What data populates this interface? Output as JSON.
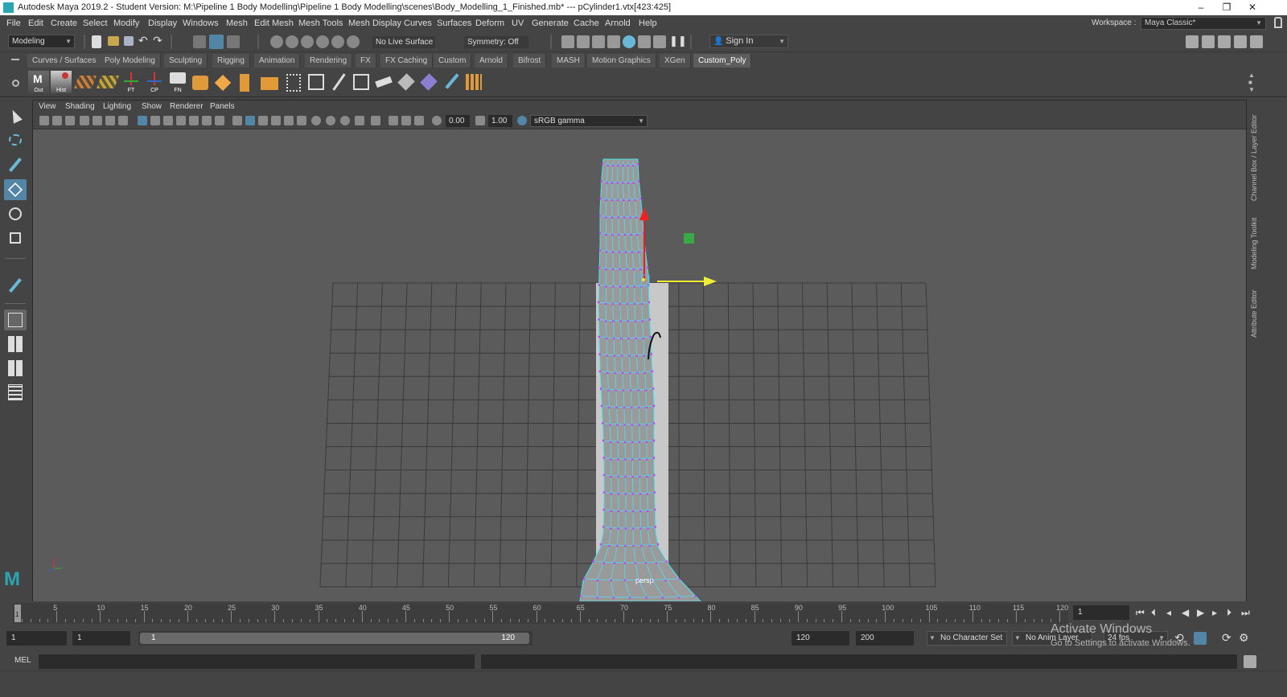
{
  "titlebar": {
    "title": "Autodesk Maya 2019.2 - Student Version: M:\\Pipeline 1 Body Modelling\\Pipeline 1 Body Modelling\\scenes\\Body_Modelling_1_Finished.mb*  ---  pCylinder1.vtx[423:425]",
    "minimize": "–",
    "restore": "❐",
    "close": "✕"
  },
  "menubar": {
    "items": [
      "File",
      "Edit",
      "Create",
      "Select",
      "Modify",
      "Display",
      "Windows",
      "Mesh",
      "Edit Mesh",
      "Mesh Tools",
      "Mesh Display",
      "Curves",
      "Surfaces",
      "Deform",
      "UV",
      "Generate",
      "Cache",
      "Arnold",
      "Help"
    ],
    "workspace_label": "Workspace :",
    "workspace_value": "Maya Classic*"
  },
  "statusline": {
    "menu_set": "Modeling",
    "live_surface": "No Live Surface",
    "symmetry": "Symmetry: Off",
    "sign_in": "Sign In"
  },
  "shelf": {
    "tabs": [
      "Curves / Surfaces",
      "Poly Modeling",
      "Sculpting",
      "Rigging",
      "Animation",
      "Rendering",
      "FX",
      "FX Caching",
      "Custom",
      "Arnold",
      "Bifrost",
      "MASH",
      "Motion Graphics",
      "XGen",
      "Custom_Poly"
    ],
    "active_tab": "Custom_Poly",
    "icon_labels": [
      "Out",
      "Hist",
      "FT",
      "CP",
      "FN"
    ]
  },
  "viewport": {
    "panel_menu": [
      "View",
      "Shading",
      "Lighting",
      "Show",
      "Renderer",
      "Panels"
    ],
    "exposure": "0.00",
    "gamma": "1.00",
    "color_space": "sRGB gamma",
    "camera_label": "persp"
  },
  "right_dock": {
    "tabs": [
      "Channel Box / Layer Editor",
      "Modeling Toolkit",
      "Attribute Editor"
    ]
  },
  "timeslider": {
    "tick_labels": [
      "5",
      "10",
      "15",
      "20",
      "25",
      "30",
      "35",
      "40",
      "45",
      "50",
      "55",
      "60",
      "65",
      "70",
      "75",
      "80",
      "85",
      "90",
      "95",
      "100",
      "105",
      "110",
      "115",
      "120"
    ],
    "current_frame_marker": "1",
    "current_frame": "1"
  },
  "rangeslider": {
    "start": "1",
    "playback_start": "1",
    "range_start": "1",
    "range_end": "120",
    "playback_end": "120",
    "end": "200",
    "character_set": "No Character Set",
    "anim_layer": "No Anim Layer",
    "fps": "24 fps"
  },
  "cmdline": {
    "label": "MEL"
  },
  "watermark": {
    "line1": "Activate Windows",
    "line2": "Go to Settings to activate Windows."
  },
  "colors": {
    "accent": "#5285a6",
    "wire": "#4ee0f0",
    "vertex": "#c040ff"
  }
}
